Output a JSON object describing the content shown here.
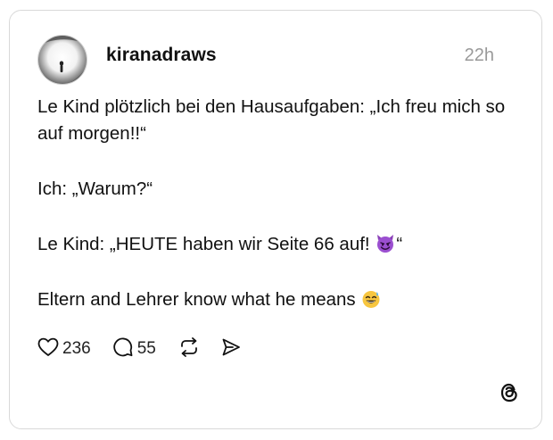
{
  "post": {
    "username": "kiranadraws",
    "timestamp": "22h",
    "paragraphs": {
      "p1": "Le Kind plötzlich bei den Hausaufgaben: „Ich freu mich so auf morgen!!“",
      "p2": "Ich: „Warum?“",
      "p3_before": "Le Kind: „HEUTE haben wir Seite 66 auf! ",
      "p3_after": "“",
      "p4": "Eltern and Lehrer know what he means "
    },
    "emojis": {
      "p3": "smiling-devil-emoji",
      "p4": "grinning-sweat-emoji"
    }
  },
  "actions": {
    "likes": "236",
    "comments": "55",
    "like_icon": "heart-icon",
    "comment_icon": "comment-icon",
    "repost_icon": "repost-icon",
    "share_icon": "share-icon"
  },
  "brand": {
    "logo": "threads-logo-icon"
  }
}
